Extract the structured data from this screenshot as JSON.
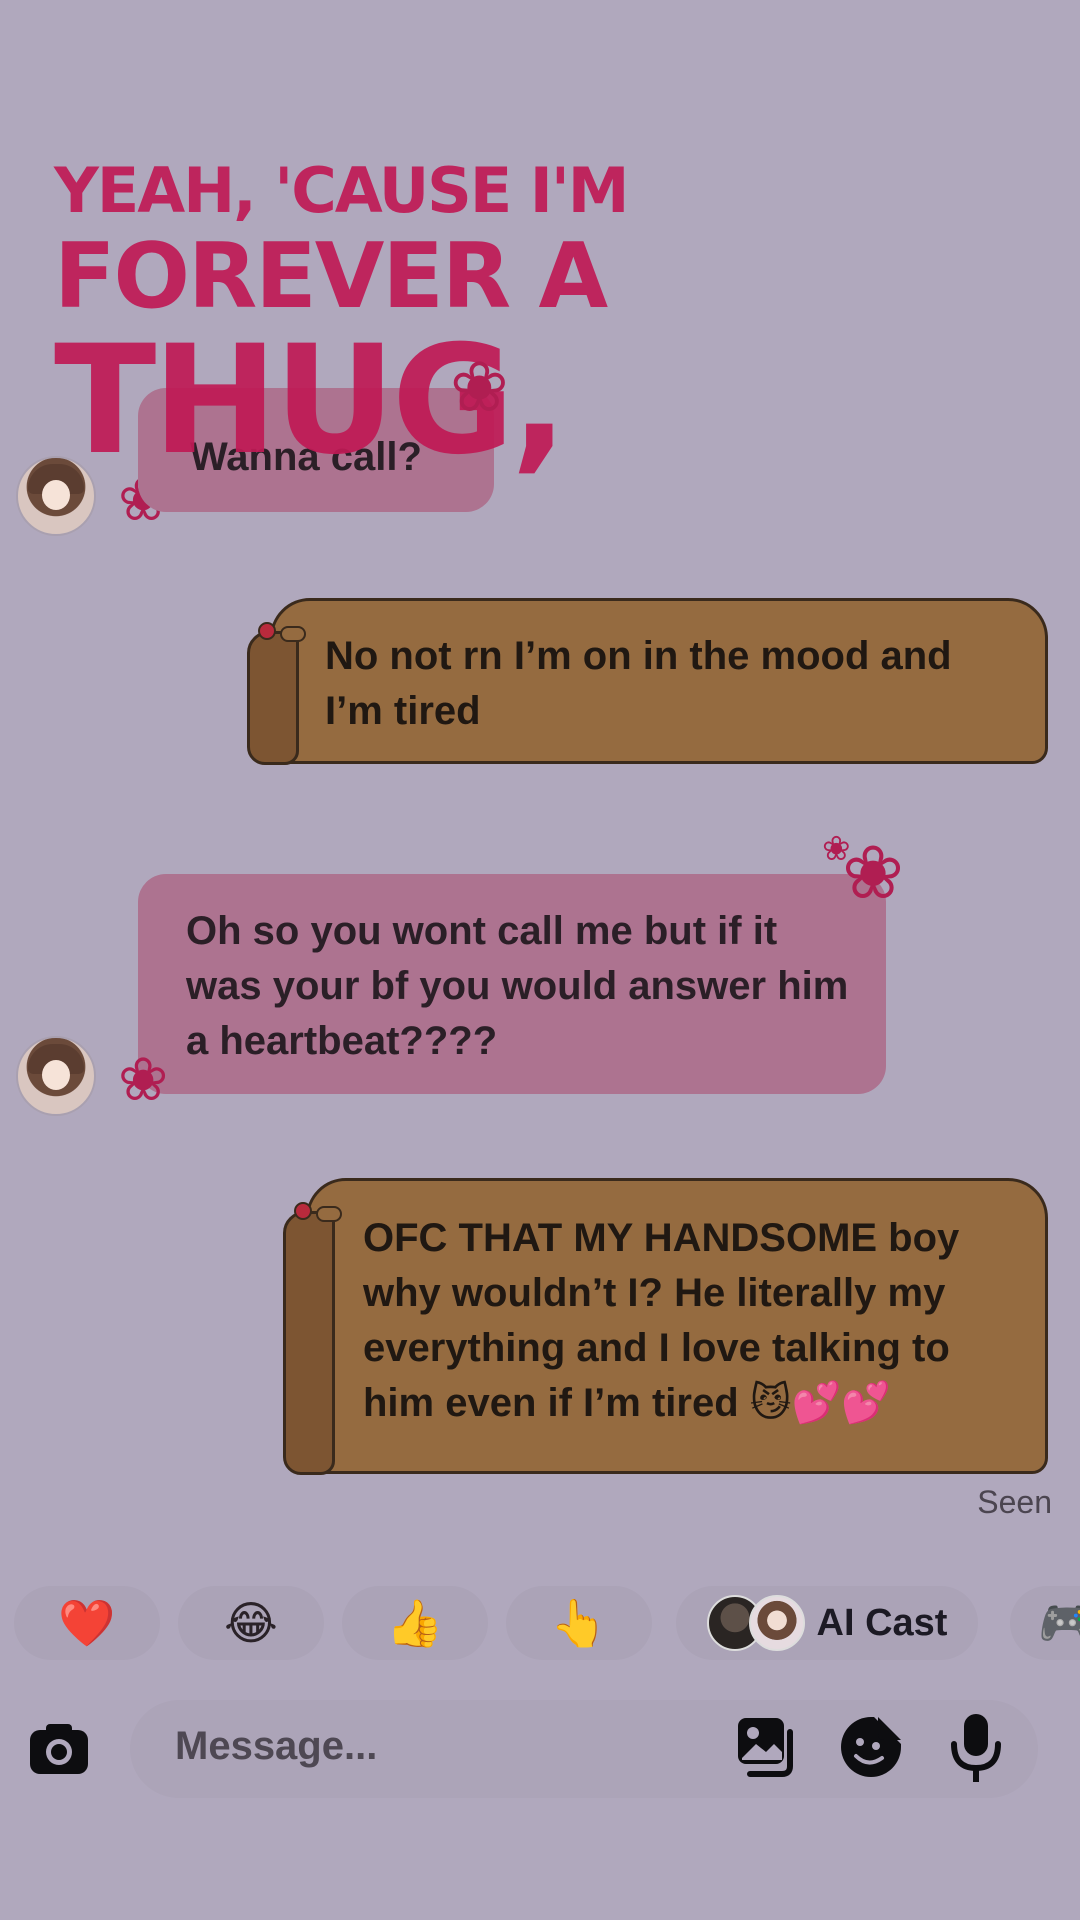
{
  "lyrics": {
    "line1": "YEAH, 'CAUSE I'M",
    "line2": "FOREVER A",
    "line3": "THUG,"
  },
  "messages": [
    {
      "direction": "incoming",
      "text": "Wanna call?"
    },
    {
      "direction": "outgoing",
      "text": "No not rn I’m on in the mood and I’m tired"
    },
    {
      "direction": "incoming",
      "text": "Oh so you wont call me but if it was your bf you would answer him a heartbeat????"
    },
    {
      "direction": "outgoing",
      "text": "OFC THAT MY HANDSOME boy why wouldn’t I? He literally my everything and I love talking to him even if I’m tired 😼💕💕"
    }
  ],
  "status": {
    "seen": "Seen"
  },
  "quick_replies": {
    "heart": "❤️",
    "laugh": "😂",
    "thumbs_up": "👍",
    "pointing": "👆",
    "ai_cast_label": "AI Cast",
    "games": "🎮"
  },
  "composer": {
    "placeholder": "Message..."
  },
  "icons": {
    "camera": "camera-icon",
    "gallery": "gallery-icon",
    "sticker": "sticker-icon",
    "mic": "microphone-icon",
    "flower": "❀"
  },
  "colors": {
    "background": "#b0a8bd",
    "incoming_bubble": "#ad7390",
    "outgoing_bubble": "#956b40",
    "lyrics": "#c01a55"
  }
}
